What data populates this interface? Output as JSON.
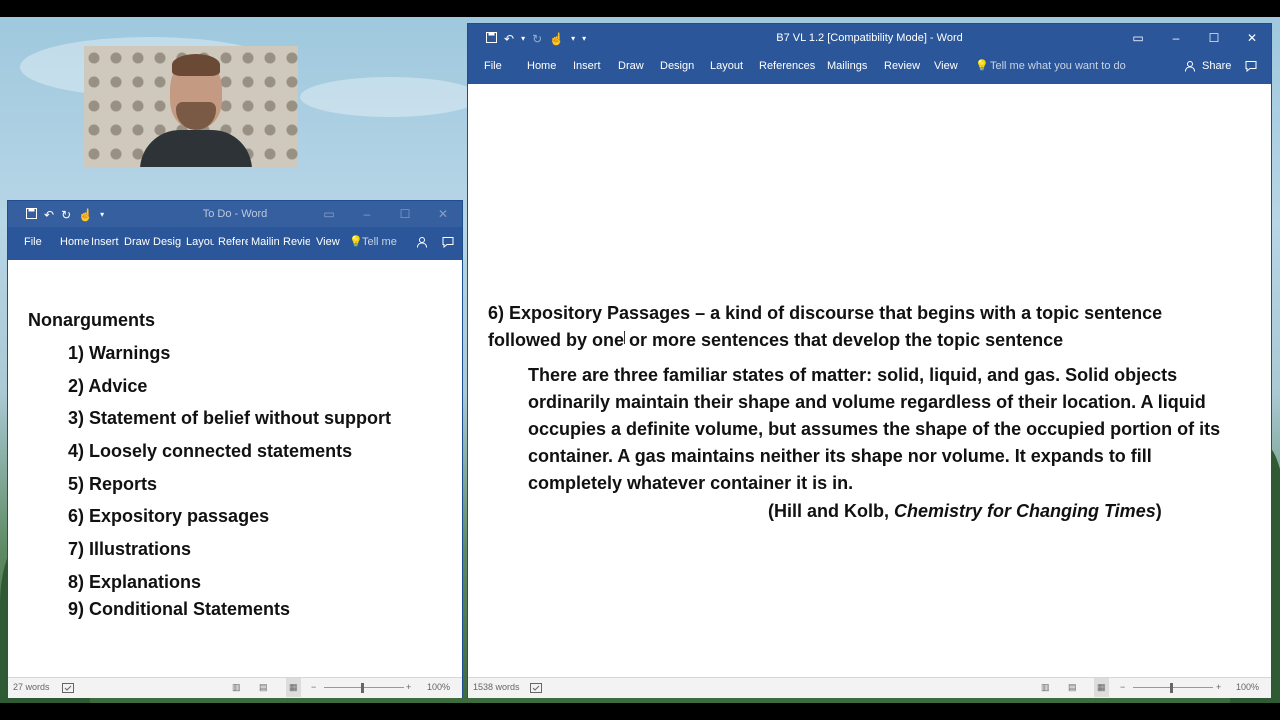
{
  "webcam": {
    "description_icon": "webcam-feed"
  },
  "left_window": {
    "title": "To Do  -  Word",
    "ribbon_tabs": [
      "File",
      "Home",
      "Insert",
      "Draw",
      "Desig",
      "Layou",
      "Refere",
      "Mailin",
      "Reviev",
      "View"
    ],
    "tell_me": "Tell me",
    "heading": "Nonarguments",
    "items": [
      "1) Warnings",
      "2) Advice",
      "3) Statement of belief without support",
      "4) Loosely connected statements",
      "5) Reports",
      "6) Expository passages",
      "7) Illustrations",
      "8) Explanations",
      "9) Conditional Statements"
    ],
    "status": {
      "words": "27 words",
      "zoom": "100%"
    }
  },
  "right_window": {
    "title": "B7 VL 1.2 [Compatibility Mode]  -  Word",
    "ribbon_tabs": [
      "File",
      "Home",
      "Insert",
      "Draw",
      "Design",
      "Layout",
      "References",
      "Mailings",
      "Review",
      "View"
    ],
    "tell_me": "Tell me what you want to do",
    "share": "Share",
    "paragraph": "6) Expository Passages – a kind of discourse that begins with a topic sentence followed by one or more sentences that develop the topic sentence",
    "quote": "There are three familiar states of matter: solid, liquid, and gas. Solid objects ordinarily maintain their shape and volume regardless of their location. A liquid occupies a definite volume, but assumes the shape of the occupied portion of its container. A gas maintains neither its shape nor volume. It expands to fill completely whatever container it is in.",
    "citation_prefix": "(Hill and Kolb, ",
    "citation_title": "Chemistry for Changing Times",
    "citation_suffix": ")",
    "status": {
      "words": "1538 words",
      "zoom": "100%"
    }
  },
  "colors": {
    "word_blue": "#2b579a",
    "status_bg": "#f3f3f3"
  }
}
